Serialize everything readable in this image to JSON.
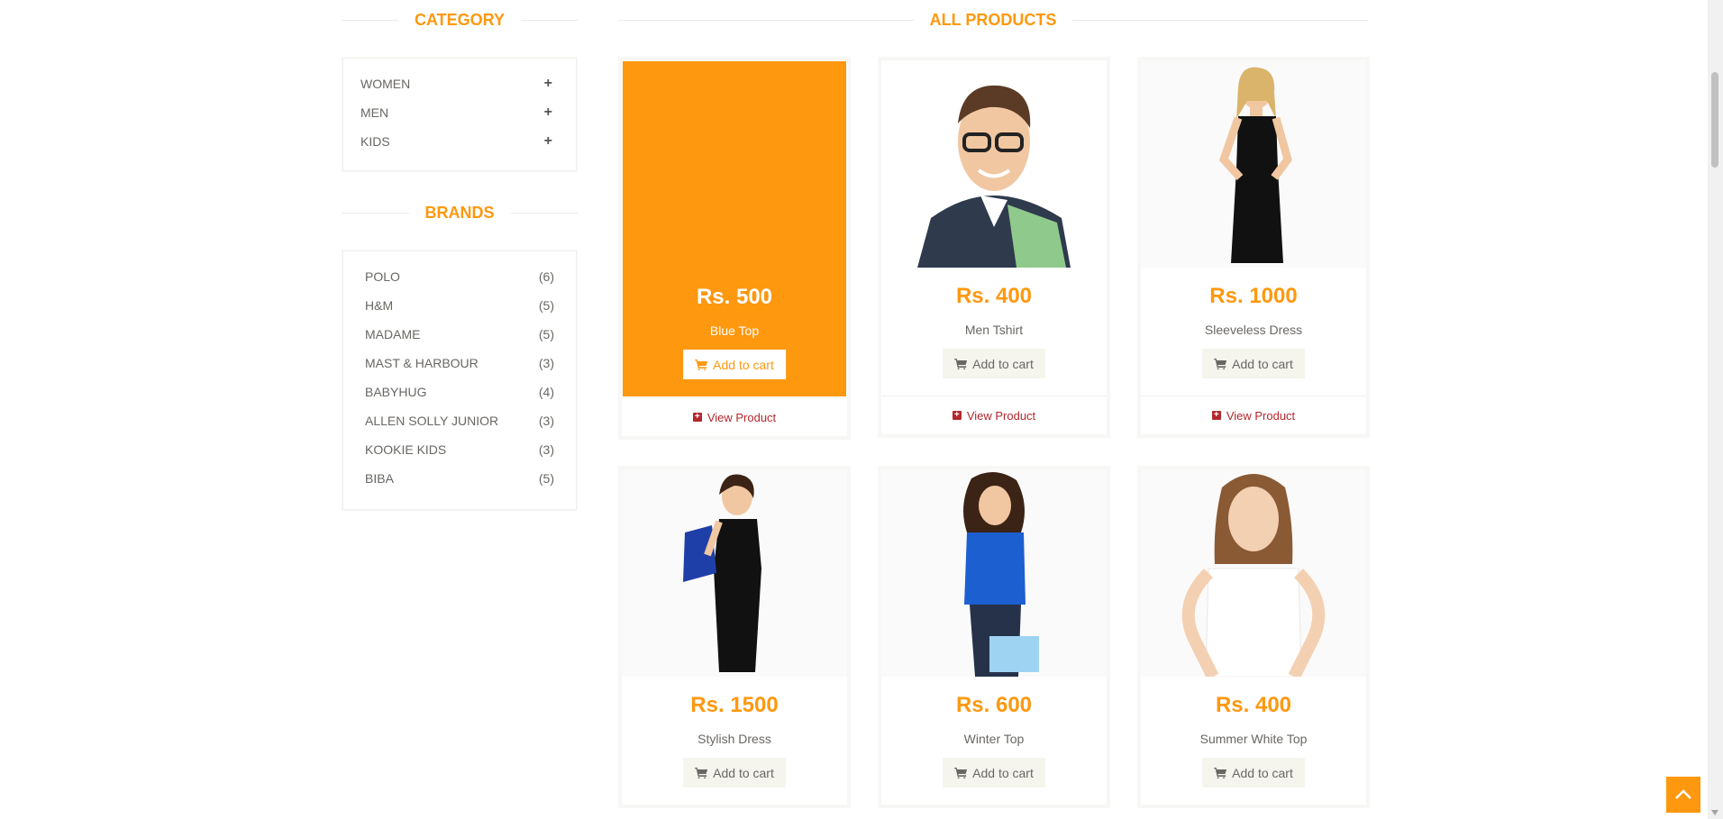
{
  "category": {
    "title": "CATEGORY",
    "items": [
      {
        "label": "WOMEN",
        "icon": "plus-icon"
      },
      {
        "label": "MEN",
        "icon": "plus-icon"
      },
      {
        "label": "KIDS",
        "icon": "plus-icon"
      }
    ]
  },
  "brands": {
    "title": "BRANDS",
    "items": [
      {
        "name": "POLO",
        "count": "(6)"
      },
      {
        "name": "H&M",
        "count": "(5)"
      },
      {
        "name": "MADAME",
        "count": "(5)"
      },
      {
        "name": "MAST & HARBOUR",
        "count": "(3)"
      },
      {
        "name": "BABYHUG",
        "count": "(4)"
      },
      {
        "name": "ALLEN SOLLY JUNIOR",
        "count": "(3)"
      },
      {
        "name": "KOOKIE KIDS",
        "count": "(3)"
      },
      {
        "name": "BIBA",
        "count": "(5)"
      }
    ]
  },
  "products": {
    "title": "ALL PRODUCTS",
    "add_to_cart_label": "Add to cart",
    "view_product_label": "View Product",
    "items": [
      {
        "price": "Rs. 500",
        "name": "Blue Top"
      },
      {
        "price": "Rs. 400",
        "name": "Men Tshirt"
      },
      {
        "price": "Rs. 1000",
        "name": "Sleeveless Dress"
      },
      {
        "price": "Rs. 1500",
        "name": "Stylish Dress"
      },
      {
        "price": "Rs. 600",
        "name": "Winter Top"
      },
      {
        "price": "Rs. 400",
        "name": "Summer White Top"
      }
    ]
  },
  "colors": {
    "accent": "#FE980F",
    "view_product": "#B3272D",
    "text": "#696763"
  }
}
